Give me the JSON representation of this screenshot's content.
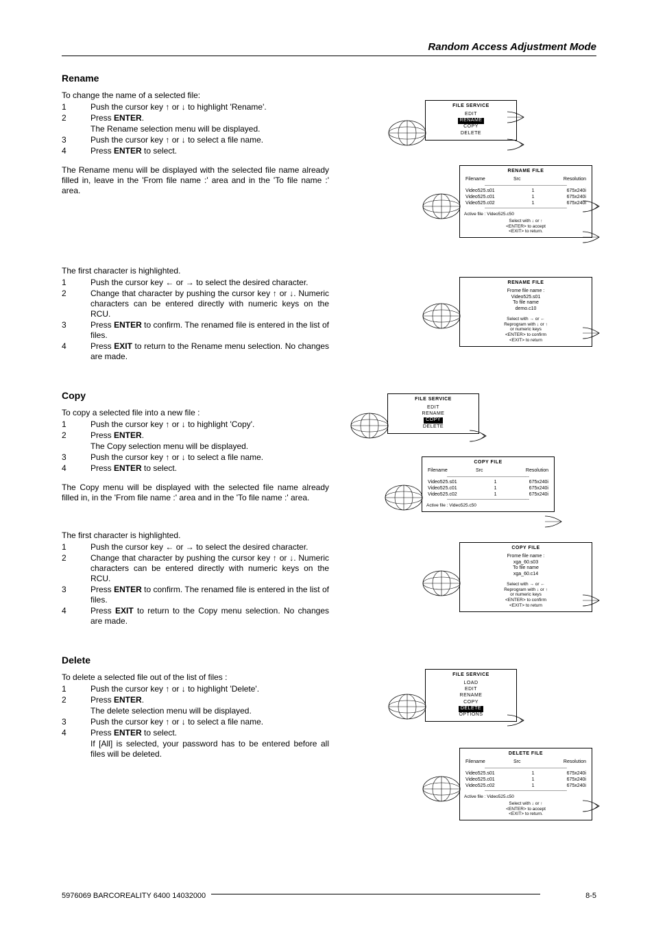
{
  "header": {
    "title": "Random Access Adjustment Mode"
  },
  "sections": {
    "rename": {
      "heading": "Rename",
      "intro": "To change the name of a selected file:",
      "steps1": [
        "Push the cursor key ↑ or ↓ to highlight 'Rename'.",
        "Press ENTER.",
        "The Rename selection menu will be displayed.",
        "Push the cursor key ↑ or ↓ to select a file name.",
        "Press ENTER to select."
      ],
      "nums1": [
        "1",
        "2",
        "",
        "3",
        "4"
      ],
      "para1": "The Rename menu will be displayed with the selected file name already filled in, leave in the 'From file name :' area and in the 'To file name :' area.",
      "intro2": "The first character is highlighted.",
      "steps2": [
        "Push the cursor key ← or → to select the desired character.",
        "Change that character by pushing the cursor key ↑ or ↓. Numeric characters can be entered directly with numeric keys on the RCU.",
        "Press ENTER to confirm.  The renamed file is entered in the list of files.",
        "Press EXIT to return to the Rename menu selection.  No changes are made."
      ],
      "nums2": [
        "1",
        "2",
        "3",
        "4"
      ]
    },
    "copy": {
      "heading": "Copy",
      "intro": "To copy a selected file into a new file :",
      "steps1": [
        "Push the cursor key ↑ or ↓ to highlight 'Copy'.",
        "Press ENTER.",
        "The Copy selection menu will be displayed.",
        "Push the cursor key ↑ or ↓ to select a file name.",
        "Press ENTER to select."
      ],
      "nums1": [
        "1",
        "2",
        "",
        "3",
        "4"
      ],
      "para1": "The Copy menu will be displayed with the selected file name already filled in, in the 'From file name :' area and in the 'To file name :' area.",
      "intro2": "The first character is highlighted.",
      "steps2": [
        "Push the cursor key ← or → to select the desired character.",
        "Change that character by pushing the cursor key ↑ or ↓. Numeric characters can be entered directly with numeric keys on the RCU.",
        "Press ENTER to confirm.  The renamed file is entered in the list of files.",
        "Press EXIT to return to the Copy menu selection.  No changes are made."
      ],
      "nums2": [
        "1",
        "2",
        "3",
        "4"
      ]
    },
    "delete": {
      "heading": "Delete",
      "intro": "To delete a selected file out of the list of files :",
      "steps1": [
        "Push the cursor key ↑ or ↓ to highlight 'Delete'.",
        "Press ENTER.",
        "The delete selection menu will be displayed.",
        "Push the cursor key ↑ or ↓ to select a file name.",
        "Press ENTER to select.",
        "If [All] is selected, your password has to be entered before all files will be deleted."
      ],
      "nums1": [
        "1",
        "2",
        "",
        "3",
        "4",
        ""
      ]
    }
  },
  "menus": {
    "fs1": {
      "title": "FILE SERVICE",
      "items": [
        "EDIT",
        "RENAME",
        "COPY",
        "DELETE"
      ],
      "sel": 1
    },
    "renamefile": {
      "title": "RENAME FILE",
      "headers": [
        "Filename",
        "Src",
        "Resolution"
      ],
      "rows": [
        [
          "Video525.s01",
          "1",
          "675x240i"
        ],
        [
          "Video525.c01",
          "1",
          "675x240i"
        ],
        [
          "Video525.c02",
          "1",
          "675x240i"
        ]
      ],
      "active": "Active file  :  Video525.c50",
      "hint": "Select with  ↓  or ↑\n<ENTER> to accept\n<EXIT> to return."
    },
    "renamefile2": {
      "title": "RENAME FILE",
      "lines": [
        "Frome file name :",
        "Video525.s01",
        "To file name",
        "demo.c10"
      ],
      "hint": "Select with → or ←\nReprogram with ↓ or ↑\nor numeric keys\n<ENTER> to confirm\n<EXIT> to return"
    },
    "fs2": {
      "title": "FILE SERVICE",
      "items": [
        "EDIT",
        "RENAME",
        "COPY",
        "DELETE"
      ],
      "sel": 2
    },
    "copyfile": {
      "title": "COPY FILE",
      "headers": [
        "Filename",
        "Src",
        "Resolution"
      ],
      "rows": [
        [
          "Video525.s01",
          "1",
          "675x240i"
        ],
        [
          "Video525.c01",
          "1",
          "675x240i"
        ],
        [
          "Video525.c02",
          "1",
          "675x240i"
        ]
      ],
      "active": "Active file :  Video525.c50"
    },
    "copyfile2": {
      "title": "COPY FILE",
      "lines": [
        "Frome file name :",
        "xga_60.s03",
        "To file name",
        "xga_60.c14"
      ],
      "hint": "Select with → or ←\nReprogram with ↓ or ↑\nor numeric keys\n<ENTER> to confirm\n<EXIT> to return"
    },
    "fs3": {
      "title": "FILE SERVICE",
      "items": [
        "LOAD",
        "EDIT",
        "RENAME",
        "COPY",
        "DELETE",
        "OPTIONS"
      ],
      "sel": 4
    },
    "deletefile": {
      "title": "DELETE FILE",
      "headers": [
        "Filename",
        "Src",
        "Resolution"
      ],
      "rows": [
        [
          "Video525.s01",
          "1",
          "675x240i"
        ],
        [
          "Video525.c01",
          "1",
          "675x240i"
        ],
        [
          "Video525.c02",
          "1",
          "675x240i"
        ]
      ],
      "active": "Active file :  Video525.c50",
      "hint": "Select with  ↓  or ↑\n<ENTER> to accept\n<EXIT> to return."
    }
  },
  "footer": {
    "left": "5976069 BARCOREALITY 6400 14032000",
    "right": "8-5"
  }
}
